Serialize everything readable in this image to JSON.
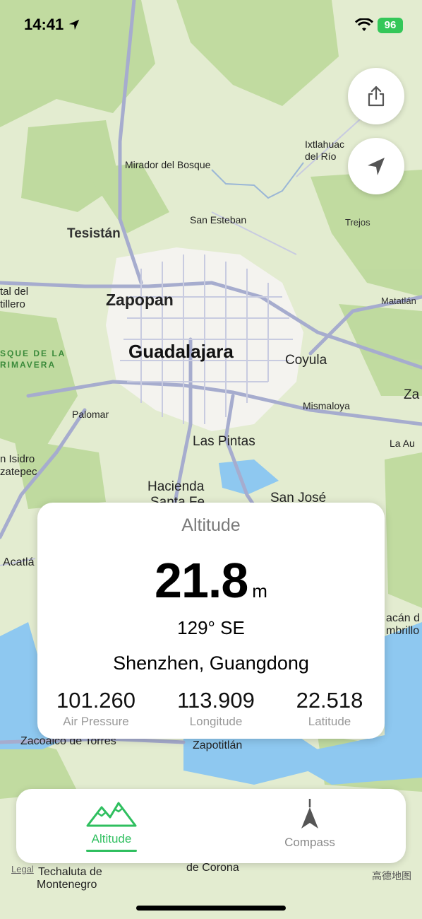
{
  "status_bar": {
    "time": "14:41",
    "battery": "96"
  },
  "map": {
    "labels": [
      {
        "text": "Mirador del Bosque",
        "kind": "small"
      },
      {
        "text": "Ixtlahuac",
        "kind": "small"
      },
      {
        "text": "del Río",
        "kind": "small"
      },
      {
        "text": "Tesistán",
        "kind": "medium"
      },
      {
        "text": "San Esteban",
        "kind": "small"
      },
      {
        "text": "Trejos",
        "kind": "tiny"
      },
      {
        "text": "Zapopan",
        "kind": "large"
      },
      {
        "text": "Guadalajara",
        "kind": "xlarge"
      },
      {
        "text": "Coyula",
        "kind": "medium"
      },
      {
        "text": "Matatlán",
        "kind": "tiny"
      },
      {
        "text": "Palomar",
        "kind": "small"
      },
      {
        "text": "Mismaloya",
        "kind": "small"
      },
      {
        "text": "Za",
        "kind": "medium"
      },
      {
        "text": "La Au",
        "kind": "small"
      },
      {
        "text": "Las Pintas",
        "kind": "medium"
      },
      {
        "text": "Hacienda",
        "kind": "medium"
      },
      {
        "text": "Santa Fe",
        "kind": "medium"
      },
      {
        "text": "San José",
        "kind": "medium"
      },
      {
        "text": "tal del",
        "kind": "small"
      },
      {
        "text": "tillero",
        "kind": "small"
      },
      {
        "text": "SQUE DE LA",
        "kind": "park"
      },
      {
        "text": "RIMAVERA",
        "kind": "park"
      },
      {
        "text": "n Isidro",
        "kind": "small"
      },
      {
        "text": "zatepec",
        "kind": "small"
      },
      {
        "text": "Acatlá",
        "kind": "small"
      },
      {
        "text": "acán d",
        "kind": "small"
      },
      {
        "text": "mbrillo",
        "kind": "small"
      },
      {
        "text": "Zacoalco de Torres",
        "kind": "small"
      },
      {
        "text": "Zapotitlán",
        "kind": "small"
      },
      {
        "text": "Techaluta de",
        "kind": "small"
      },
      {
        "text": "Montenegro",
        "kind": "small"
      },
      {
        "text": "de Corona",
        "kind": "small"
      }
    ],
    "legal": "Legal",
    "attribution": "高德地图"
  },
  "buttons": {
    "share": "share-icon",
    "locate": "location-arrow-icon"
  },
  "card": {
    "title": "Altitude",
    "altitude_value": "21.8",
    "altitude_unit": "m",
    "heading": "129° SE",
    "place": "Shenzhen, Guangdong",
    "stats": [
      {
        "value": "101.260",
        "label": "Air Pressure"
      },
      {
        "value": "113.909",
        "label": "Longitude"
      },
      {
        "value": "22.518",
        "label": "Latitude"
      }
    ]
  },
  "tabs": [
    {
      "label": "Altitude",
      "icon": "mountains-icon",
      "active": true
    },
    {
      "label": "Compass",
      "icon": "compass-arrow-icon",
      "active": false
    }
  ],
  "colors": {
    "accent": "#2fbf5f",
    "land": "#e3ecd0",
    "forest": "#bcd99a",
    "water": "#8ec8f0",
    "urban": "#f3f2ee",
    "road": "#9aa0c4"
  }
}
